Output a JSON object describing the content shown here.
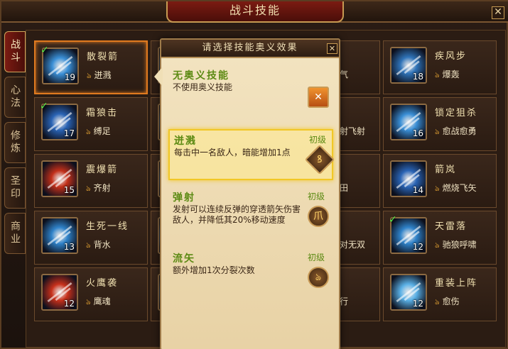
{
  "window": {
    "title": "战斗技能",
    "close_glyph": "✕"
  },
  "tabs": [
    {
      "label": "战斗",
      "active": true
    },
    {
      "label": "心法",
      "active": false
    },
    {
      "label": "修炼",
      "active": false
    },
    {
      "label": "圣印",
      "active": false
    },
    {
      "label": "商业",
      "active": false
    }
  ],
  "skills_left": [
    {
      "name": "散裂箭",
      "level": "19",
      "effect": "迸溅",
      "checked": true,
      "selected": true,
      "icon": "arrow-split-icon",
      "color": "#3a8fd6"
    },
    {
      "name": "霜狼击",
      "level": "17",
      "effect": "缚足",
      "checked": true,
      "selected": false,
      "icon": "frost-wolf-icon",
      "color": "#2a64b5"
    },
    {
      "name": "震爆箭",
      "level": "15",
      "effect": "齐射",
      "checked": false,
      "selected": false,
      "icon": "blast-arrow-icon",
      "color": "#c2301a"
    },
    {
      "name": "生死一线",
      "level": "13",
      "effect": "背水",
      "checked": false,
      "selected": false,
      "icon": "life-line-icon",
      "color": "#2f82c9"
    },
    {
      "name": "火鹰袭",
      "level": "12",
      "effect": "鹰魂",
      "checked": false,
      "selected": false,
      "icon": "fire-hawk-icon",
      "color": "#c7301b"
    }
  ],
  "skills_right": [
    {
      "name": "疾风步",
      "level": "18",
      "effect": "爆轰",
      "checked": false,
      "icon": "gale-step-icon",
      "color": "#2f73b8"
    },
    {
      "name": "锁定狙杀",
      "level": "16",
      "effect": "愈战愈勇",
      "checked": false,
      "icon": "lock-snipe-icon",
      "color": "#3a8fd6"
    },
    {
      "name": "箭岚",
      "level": "14",
      "effect": "燃烧飞矢",
      "checked": false,
      "icon": "arrow-storm-icon",
      "color": "#2a64b5"
    },
    {
      "name": "天雷落",
      "level": "12",
      "effect": "驰狼呼啸",
      "checked": true,
      "icon": "thunder-fall-icon",
      "color": "#2f82c9"
    },
    {
      "name": "重装上阵",
      "level": "12",
      "effect": "愈伤",
      "checked": false,
      "icon": "heavy-armor-icon",
      "color": "#5ab0e6"
    }
  ],
  "partial_middle": [
    "气",
    "射飞射",
    "田",
    "对无双",
    "行"
  ],
  "popup": {
    "title": "请选择技能奥义效果",
    "close_glyph": "✕",
    "options": [
      {
        "title": "无奥义技能",
        "grade": "",
        "desc": "不使用奥义技能",
        "button": "✕",
        "highlight": false,
        "icon": "cancel-icon"
      },
      {
        "title": "迸溅",
        "grade": "初级",
        "desc": "每击中一名敌人，暗能增加1点",
        "button": "ꝸ",
        "highlight": true,
        "icon": "splash-rune-icon"
      },
      {
        "title": "弹射",
        "grade": "初级",
        "desc": "发射可以连续反弹的穿透箭矢伤害敌人，并降低其20%移动速度",
        "button": "爪",
        "highlight": false,
        "icon": "ricochet-rune-icon"
      },
      {
        "title": "流矢",
        "grade": "初级",
        "desc": "额外增加1次分裂次数",
        "button": "ঌ",
        "highlight": false,
        "icon": "stray-arrow-rune-icon"
      }
    ]
  }
}
